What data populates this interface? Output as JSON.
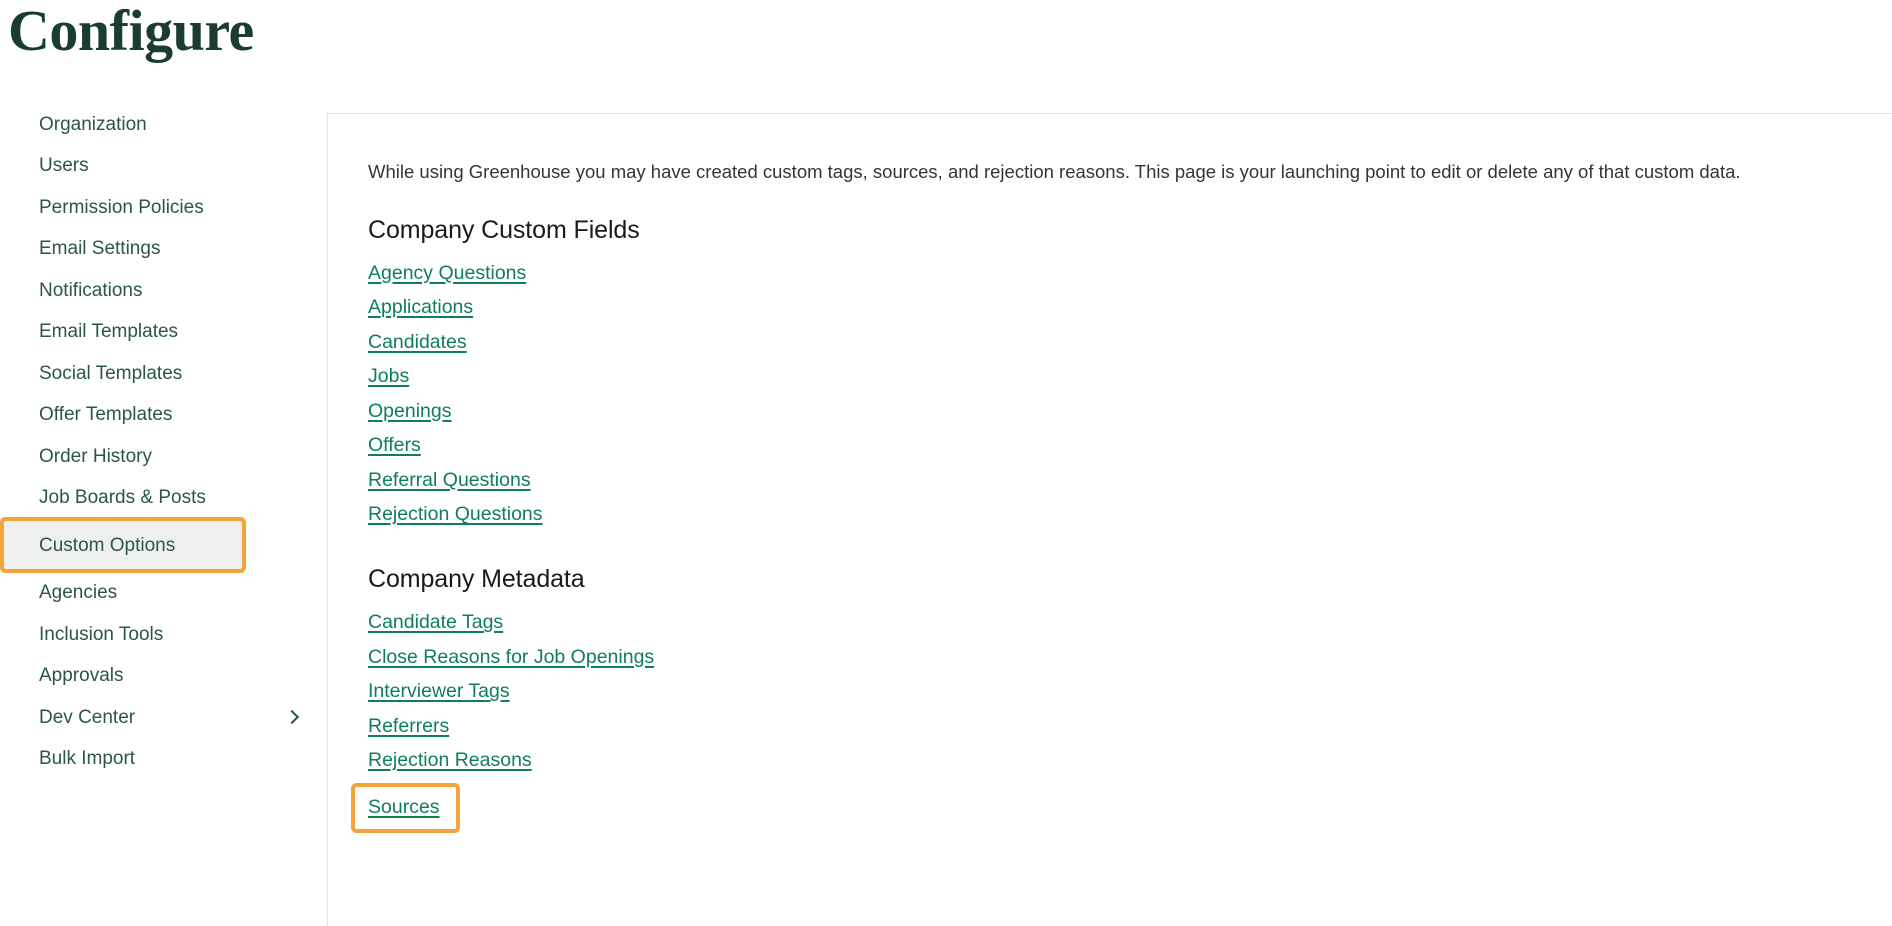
{
  "page": {
    "title": "Configure"
  },
  "sidebar": {
    "items": [
      {
        "label": "Organization",
        "selected": false,
        "has_chevron": false
      },
      {
        "label": "Users",
        "selected": false,
        "has_chevron": false
      },
      {
        "label": "Permission Policies",
        "selected": false,
        "has_chevron": false
      },
      {
        "label": "Email Settings",
        "selected": false,
        "has_chevron": false
      },
      {
        "label": "Notifications",
        "selected": false,
        "has_chevron": false
      },
      {
        "label": "Email Templates",
        "selected": false,
        "has_chevron": false
      },
      {
        "label": "Social Templates",
        "selected": false,
        "has_chevron": false
      },
      {
        "label": "Offer Templates",
        "selected": false,
        "has_chevron": false
      },
      {
        "label": "Order History",
        "selected": false,
        "has_chevron": false
      },
      {
        "label": "Job Boards & Posts",
        "selected": false,
        "has_chevron": false
      },
      {
        "label": "Custom Options",
        "selected": true,
        "has_chevron": false
      },
      {
        "label": "Agencies",
        "selected": false,
        "has_chevron": false
      },
      {
        "label": "Inclusion Tools",
        "selected": false,
        "has_chevron": false
      },
      {
        "label": "Approvals",
        "selected": false,
        "has_chevron": false
      },
      {
        "label": "Dev Center",
        "selected": false,
        "has_chevron": true
      },
      {
        "label": "Bulk Import",
        "selected": false,
        "has_chevron": false
      }
    ]
  },
  "main": {
    "intro": "While using Greenhouse you may have created custom tags, sources, and rejection reasons. This page is your launching point to edit or delete any of that custom data.",
    "sections": [
      {
        "heading": "Company Custom Fields",
        "links": [
          {
            "label": "Agency Questions",
            "highlighted": false
          },
          {
            "label": "Applications",
            "highlighted": false
          },
          {
            "label": "Candidates",
            "highlighted": false
          },
          {
            "label": "Jobs",
            "highlighted": false
          },
          {
            "label": "Openings",
            "highlighted": false
          },
          {
            "label": "Offers",
            "highlighted": false
          },
          {
            "label": "Referral Questions",
            "highlighted": false
          },
          {
            "label": "Rejection Questions",
            "highlighted": false
          }
        ]
      },
      {
        "heading": "Company Metadata",
        "links": [
          {
            "label": "Candidate Tags",
            "highlighted": false
          },
          {
            "label": "Close Reasons for Job Openings",
            "highlighted": false
          },
          {
            "label": "Interviewer Tags",
            "highlighted": false
          },
          {
            "label": "Referrers",
            "highlighted": false
          },
          {
            "label": "Rejection Reasons",
            "highlighted": false
          },
          {
            "label": "Sources",
            "highlighted": true
          }
        ]
      }
    ]
  },
  "colors": {
    "highlight_orange": "#f5a33c",
    "link_green": "#0f7f56",
    "title_green": "#1b3d31",
    "sidebar_text": "#2d5549",
    "selected_bg": "#eef0ef"
  }
}
